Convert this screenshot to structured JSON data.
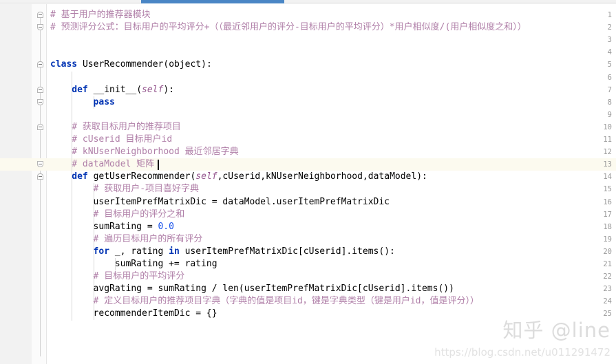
{
  "topbar": {
    "thumb_color": "#4a86c5",
    "track_color": "#f2f2f2"
  },
  "editor": {
    "language": "Python",
    "current_line": 13,
    "highlight_color": "#fcfaef",
    "gutter_color": "#f2f2f2",
    "line_number_color": "#999999",
    "comment_color": "#b07fa8",
    "keyword_color": "#0033b3",
    "number_color": "#1750eb",
    "param_color": "#94558d"
  },
  "lines": [
    {
      "n": 1,
      "indent": 0,
      "tokens": [
        {
          "t": "cmt",
          "s": "# 基于用户的推荐器模块"
        }
      ]
    },
    {
      "n": 2,
      "indent": 0,
      "tokens": [
        {
          "t": "cmt",
          "s": "# 预测评分公式：目标用户的平均评分+（（最近邻用户的评分-目标用户的平均评分）*用户相似度/(用户相似度之和））"
        }
      ]
    },
    {
      "n": 3,
      "indent": 0,
      "tokens": []
    },
    {
      "n": 4,
      "indent": 0,
      "tokens": []
    },
    {
      "n": 5,
      "indent": 0,
      "tokens": [
        {
          "t": "kw",
          "s": "class"
        },
        {
          "t": "plain",
          "s": " "
        },
        {
          "t": "cls",
          "s": "UserRecommender"
        },
        {
          "t": "plain",
          "s": "(object):"
        }
      ]
    },
    {
      "n": 6,
      "indent": 0,
      "tokens": []
    },
    {
      "n": 7,
      "indent": 1,
      "tokens": [
        {
          "t": "kw",
          "s": "def"
        },
        {
          "t": "plain",
          "s": " "
        },
        {
          "t": "fn",
          "s": "__init__"
        },
        {
          "t": "plain",
          "s": "("
        },
        {
          "t": "self",
          "s": "self"
        },
        {
          "t": "plain",
          "s": "):"
        }
      ]
    },
    {
      "n": 8,
      "indent": 2,
      "tokens": [
        {
          "t": "kw",
          "s": "pass"
        }
      ]
    },
    {
      "n": 9,
      "indent": 0,
      "tokens": []
    },
    {
      "n": 10,
      "indent": 1,
      "tokens": [
        {
          "t": "cmt",
          "s": "# 获取目标用户的推荐项目"
        }
      ]
    },
    {
      "n": 11,
      "indent": 1,
      "tokens": [
        {
          "t": "cmt",
          "s": "# cUserid 目标用户id"
        }
      ]
    },
    {
      "n": 12,
      "indent": 1,
      "tokens": [
        {
          "t": "cmt",
          "s": "# kNUserNeighborhood 最近邻居字典"
        }
      ]
    },
    {
      "n": 13,
      "indent": 1,
      "tokens": [
        {
          "t": "cmt",
          "s": "# dataModel 矩阵"
        }
      ]
    },
    {
      "n": 14,
      "indent": 1,
      "tokens": [
        {
          "t": "kw",
          "s": "def"
        },
        {
          "t": "plain",
          "s": " "
        },
        {
          "t": "fn",
          "s": "getUserRecommender"
        },
        {
          "t": "plain",
          "s": "("
        },
        {
          "t": "self",
          "s": "self"
        },
        {
          "t": "plain",
          "s": ",cUserid,kNUserNeighborhood,dataModel):"
        }
      ]
    },
    {
      "n": 15,
      "indent": 2,
      "tokens": [
        {
          "t": "cmt",
          "s": "# 获取用户-项目喜好字典"
        }
      ]
    },
    {
      "n": 16,
      "indent": 2,
      "tokens": [
        {
          "t": "plain",
          "s": "userItemPrefMatrixDic = dataModel.userItemPrefMatrixDic"
        }
      ]
    },
    {
      "n": 17,
      "indent": 2,
      "tokens": [
        {
          "t": "cmt",
          "s": "# 目标用户的评分之和"
        }
      ]
    },
    {
      "n": 18,
      "indent": 2,
      "tokens": [
        {
          "t": "plain",
          "s": "sumRating = "
        },
        {
          "t": "num",
          "s": "0.0"
        }
      ]
    },
    {
      "n": 19,
      "indent": 2,
      "tokens": [
        {
          "t": "cmt",
          "s": "# 遍历目标用户的所有评分"
        }
      ]
    },
    {
      "n": 20,
      "indent": 2,
      "tokens": [
        {
          "t": "kw",
          "s": "for"
        },
        {
          "t": "plain",
          "s": " _, rating "
        },
        {
          "t": "kw",
          "s": "in"
        },
        {
          "t": "plain",
          "s": " userItemPrefMatrixDic[cUserid].items():"
        }
      ]
    },
    {
      "n": 21,
      "indent": 3,
      "tokens": [
        {
          "t": "plain",
          "s": "sumRating += rating"
        }
      ]
    },
    {
      "n": 22,
      "indent": 2,
      "tokens": [
        {
          "t": "cmt",
          "s": "# 目标用户的平均评分"
        }
      ]
    },
    {
      "n": 23,
      "indent": 2,
      "tokens": [
        {
          "t": "plain",
          "s": "avgRating = sumRating / len(userItemPrefMatrixDic[cUserid].items())"
        }
      ]
    },
    {
      "n": 24,
      "indent": 2,
      "tokens": [
        {
          "t": "cmt",
          "s": "# 定义目标用户的推荐项目字典（字典的值是项目id，键是字典类型（键是用户id，值是评分））"
        }
      ]
    },
    {
      "n": 25,
      "indent": 2,
      "tokens": [
        {
          "t": "plain",
          "s": "recommenderItemDic = {}"
        }
      ]
    }
  ],
  "fold_markers": [
    {
      "line": 1,
      "shape": "roundtop"
    },
    {
      "line": 2,
      "shape": "round"
    },
    {
      "line": 5,
      "shape": "roundtop"
    },
    {
      "line": 7,
      "shape": "roundtop"
    },
    {
      "line": 8,
      "shape": "round"
    },
    {
      "line": 10,
      "shape": "roundtop"
    },
    {
      "line": 13,
      "shape": "round"
    },
    {
      "line": 14,
      "shape": "roundtop"
    }
  ],
  "watermark": {
    "brand": "知乎 @line",
    "url": "https://blog.csdn.net/u011291472"
  }
}
